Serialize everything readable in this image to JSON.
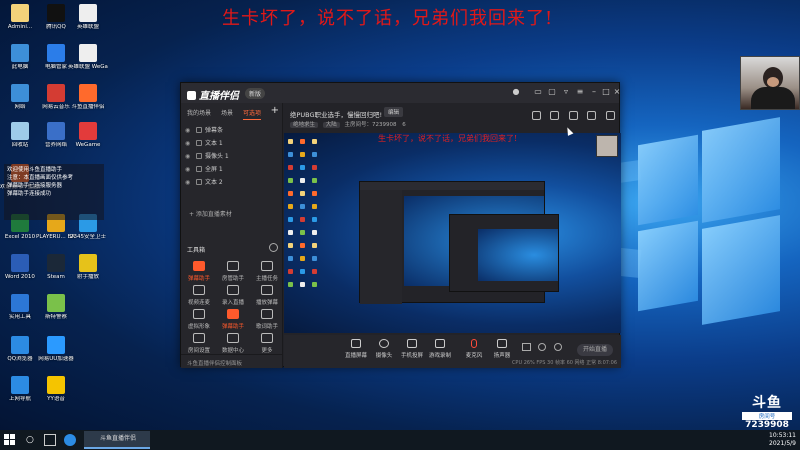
{
  "danmaku": "生卡坏了，说不了话，兄弟们我回来了!",
  "desktop_icons": [
    {
      "label": "Admini...",
      "color": "#f3d27a"
    },
    {
      "label": "此电脑",
      "color": "#3d8fd8"
    },
    {
      "label": "网络",
      "color": "#3d8fd8"
    },
    {
      "label": "回收站",
      "color": "#9ecbe9"
    },
    {
      "label": "欢迎使用斗鱼直播助手",
      "color": "#ff6a2c"
    },
    {
      "label": "Excel 2010",
      "color": "#1f7a3c"
    },
    {
      "label": "Word 2010",
      "color": "#2b5db6"
    },
    {
      "label": "实用工具",
      "color": "#2c77d6"
    },
    {
      "label": "QQ浏览器",
      "color": "#2c8be3"
    },
    {
      "label": "上网导航",
      "color": "#2c8be3"
    },
    {
      "label": "腾讯QQ",
      "color": "#111"
    },
    {
      "label": "电脑管家",
      "color": "#2b7de9"
    },
    {
      "label": "网易云音乐",
      "color": "#d43c33"
    },
    {
      "label": "营养网络",
      "color": "#3a6fc8"
    },
    {
      "label": "PLAYERU... BATTLEGR...",
      "color": "#e6a81a"
    },
    {
      "label": "Steam",
      "color": "#1b2838"
    },
    {
      "label": "斯特警察",
      "color": "#7ac14a"
    },
    {
      "label": "网易UU加速器",
      "color": "#2b9aff"
    },
    {
      "label": "YY语音",
      "color": "#f5c400"
    },
    {
      "label": "英雄联盟",
      "color": "#eee"
    },
    {
      "label": "英雄联盟 WeGame版",
      "color": "#eee"
    },
    {
      "label": "斗鱼直播伴侣",
      "color": "#ff6a2c"
    },
    {
      "label": "WeGame",
      "color": "#e33b3b"
    },
    {
      "label": "2345安全卫士",
      "color": "#2b9ae6"
    },
    {
      "label": "射手播放",
      "color": "#e6c21a"
    }
  ],
  "notify_lines": [
    "欢迎使用斗鱼直播助手",
    "注意：本直播画面仅供参考",
    "弹幕助手已连接服务器",
    "弹幕助手连接成功"
  ],
  "app": {
    "logo": "直播伴侣",
    "version": "新版",
    "tabs": [
      "我的场景",
      "场景",
      "可选项"
    ],
    "scenes": [
      "弹幕条",
      "文本 1",
      "摄像头 1",
      "全屏 1",
      "文本 2"
    ],
    "add_source": "+ 添加直播素材",
    "tools_header": "工具箱",
    "tools": [
      {
        "label": "弹幕助手",
        "hot": true
      },
      {
        "label": "房管助手",
        "hot": false
      },
      {
        "label": "主播任务",
        "hot": false
      },
      {
        "label": "视频连麦",
        "hot": false
      },
      {
        "label": "录入直播",
        "hot": false
      },
      {
        "label": "播放弹幕",
        "hot": false
      },
      {
        "label": "虚拟形象",
        "hot": false
      },
      {
        "label": "弹幕助手",
        "hot": true
      },
      {
        "label": "歌词助手",
        "hot": false
      },
      {
        "label": "房间设置",
        "hot": false
      },
      {
        "label": "数据中心",
        "hot": false
      },
      {
        "label": "更多",
        "hot": false
      }
    ],
    "left_status": "斗鱼直播伴侣控制面板",
    "room_title": "绝PUBG职业选手，慢慢回归吧!",
    "edit_label": "编辑",
    "room_meta": [
      "绝地求生",
      "大陆",
      "主房间号：7239908",
      "6"
    ],
    "controls": [
      "直播屏幕",
      "摄像头",
      "手机投屏",
      "游戏录制",
      "麦克风",
      "扬声器"
    ],
    "start_label": "开始直播",
    "status_line": "CPU 26%   FPS 30   帧率 60   网络 正常   8:07:06"
  },
  "douyu": {
    "brand": "斗鱼",
    "room_label": "房间号",
    "room_number": "7239908"
  },
  "taskbar": {
    "app_label": "斗鱼直播伴侣",
    "time": "10:53:11",
    "date": "2021/5/9"
  }
}
